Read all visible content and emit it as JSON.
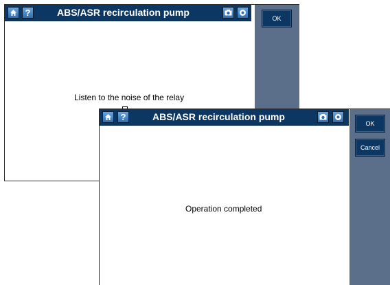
{
  "dialog_back": {
    "title": "ABS/ASR recirculation pump",
    "message": "Listen to the noise of the relay",
    "ok_label": "OK"
  },
  "dialog_front": {
    "title": "ABS/ASR recirculation pump",
    "message": "Operation completed",
    "ok_label": "OK",
    "cancel_label": "Cancel"
  },
  "icons": {
    "home": "home-icon",
    "help": "question-mark-icon",
    "camera": "camera-icon",
    "record": "record-icon"
  },
  "colors": {
    "titlebar": "#0c3763",
    "sidebar": "#5b6f8b",
    "toolbar_button": "#2f6fb1"
  }
}
